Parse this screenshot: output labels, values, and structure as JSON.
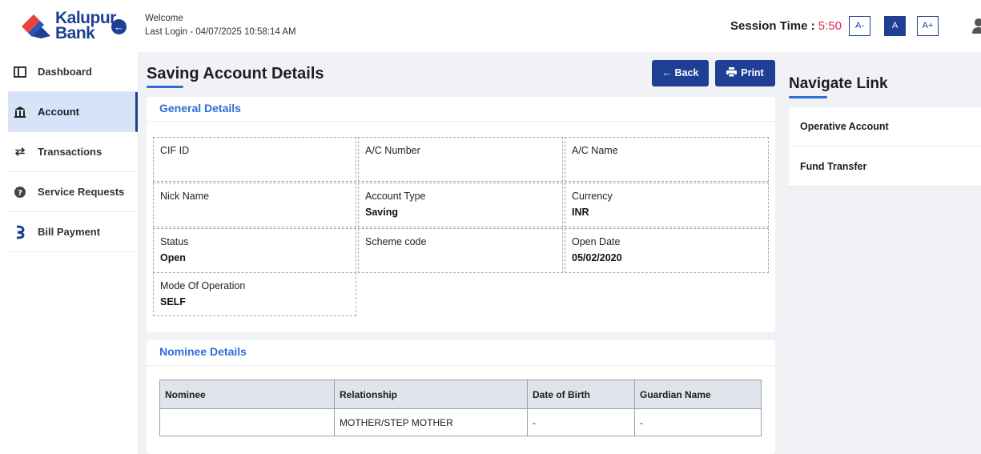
{
  "header": {
    "brand_line1": "Kalupur",
    "brand_line2": "Bank",
    "welcome": "Welcome",
    "last_login": "Last Login - 04/07/2025 10:58:14 AM",
    "session_label": "Session Time : ",
    "session_time": "5:50",
    "font_small": "A-",
    "font_normal": "A",
    "font_large": "A+"
  },
  "sidebar": {
    "items": [
      {
        "label": "Dashboard",
        "icon": "dashboard-icon"
      },
      {
        "label": "Account",
        "icon": "bank-icon"
      },
      {
        "label": "Transactions",
        "icon": "swap-arrows-icon"
      },
      {
        "label": "Service Requests",
        "icon": "question-icon"
      },
      {
        "label": "Bill Payment",
        "icon": "bill-payment-icon"
      }
    ],
    "active": "Account"
  },
  "main": {
    "title": "Saving Account Details",
    "back_label": "← Back",
    "print_label": "Print"
  },
  "general": {
    "title": "General Details",
    "fields": [
      {
        "key": "CIF ID",
        "value": ""
      },
      {
        "key": "A/C Number",
        "value": ""
      },
      {
        "key": "A/C Name",
        "value": ""
      },
      {
        "key": "Nick Name",
        "value": ""
      },
      {
        "key": "Account Type",
        "value": "Saving"
      },
      {
        "key": "Currency",
        "value": "INR"
      },
      {
        "key": "Status",
        "value": "Open"
      },
      {
        "key": "Scheme code",
        "value": ""
      },
      {
        "key": "Open Date",
        "value": "05/02/2020"
      },
      {
        "key": "Mode Of Operation",
        "value": "SELF"
      }
    ]
  },
  "nominee": {
    "title": "Nominee Details",
    "columns": [
      "Nominee",
      "Relationship",
      "Date of Birth",
      "Guardian Name"
    ],
    "rows": [
      [
        "",
        "MOTHER/STEP MOTHER",
        "-",
        "-"
      ]
    ]
  },
  "navigate": {
    "title": "Navigate Link",
    "items": [
      "Operative Account",
      "Fund Transfer"
    ]
  },
  "colors": {
    "brand": "#1e3f94",
    "accent": "#2f6cd6",
    "session_time": "#e0264e",
    "active_nav_bg": "#d6e3f8"
  }
}
